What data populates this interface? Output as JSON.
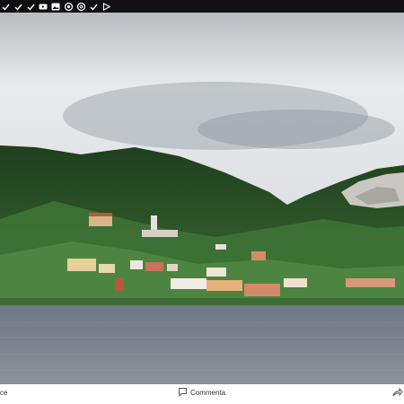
{
  "status_bar": {
    "icons": [
      "check-icon",
      "check-icon",
      "check-icon",
      "check-icon",
      "youtube-icon",
      "gallery-icon",
      "chrome-icon",
      "at-icon",
      "check-icon",
      "play-store-icon"
    ]
  },
  "photo": {
    "description_colors": {
      "sky": "#dcdfe1",
      "hills": "#2f5a2c",
      "lake": "#7d8590"
    }
  },
  "bottom_bar": {
    "left_text": "ce",
    "comment_label": "Commenta"
  }
}
